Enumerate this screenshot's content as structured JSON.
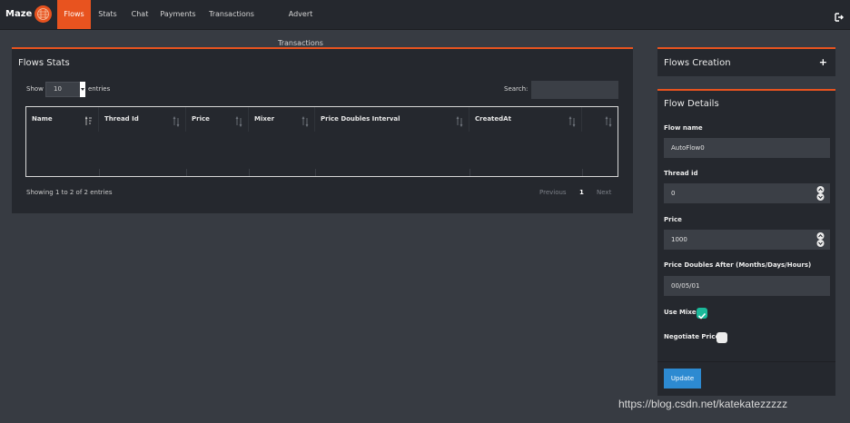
{
  "brand": {
    "name": "Maze"
  },
  "nav": {
    "items": [
      {
        "label": "Flows",
        "active": true
      },
      {
        "label": "Stats",
        "active": false
      },
      {
        "label": "Chat",
        "active": false
      },
      {
        "label": "Payments",
        "active": false
      },
      {
        "label": "Transactions",
        "active": false
      },
      {
        "label": "Advert Transactions",
        "active": false
      }
    ],
    "right_icon": "logout-icon"
  },
  "stats_panel": {
    "title": "Flows Stats",
    "show_label": "Show",
    "entries_value": "10",
    "entries_label": "entries",
    "search_label": "Search:",
    "search_value": "",
    "table": {
      "headers": [
        "Name",
        "Thread Id",
        "Price",
        "Mixer",
        "Price Doubles Interval",
        "CreatedAt",
        ""
      ],
      "rows": []
    },
    "info": "Showing 1 to 2 of 2 entries",
    "pagination": {
      "previous": "Previous",
      "current": "1",
      "next": "Next"
    }
  },
  "creation_panel": {
    "title": "Flows Creation",
    "action_icon": "plus-icon",
    "action_label": "+"
  },
  "details_panel": {
    "title": "Flow Details",
    "flow_name_label": "Flow name",
    "flow_name_value": "AutoFlow0",
    "thread_id_label": "Thread id",
    "thread_id_value": "0",
    "price_label": "Price",
    "price_value": "1000",
    "price_doubles_label": "Price Doubles After (Months/Days/Hours)",
    "price_doubles_value": "00/05/01",
    "use_mixer_label": "Use Mixer",
    "use_mixer_checked": true,
    "negotiate_label": "Negotiate Price",
    "negotiate_checked": false,
    "update_label": "Update"
  },
  "colors": {
    "accent": "#e8531f",
    "background": "#373b42",
    "panel": "#25282e",
    "input": "#3b3f46",
    "checkbox_on": "#1bb99a",
    "button": "#2d8ad1"
  },
  "watermark": "https://blog.csdn.net/katekatezzzzz"
}
